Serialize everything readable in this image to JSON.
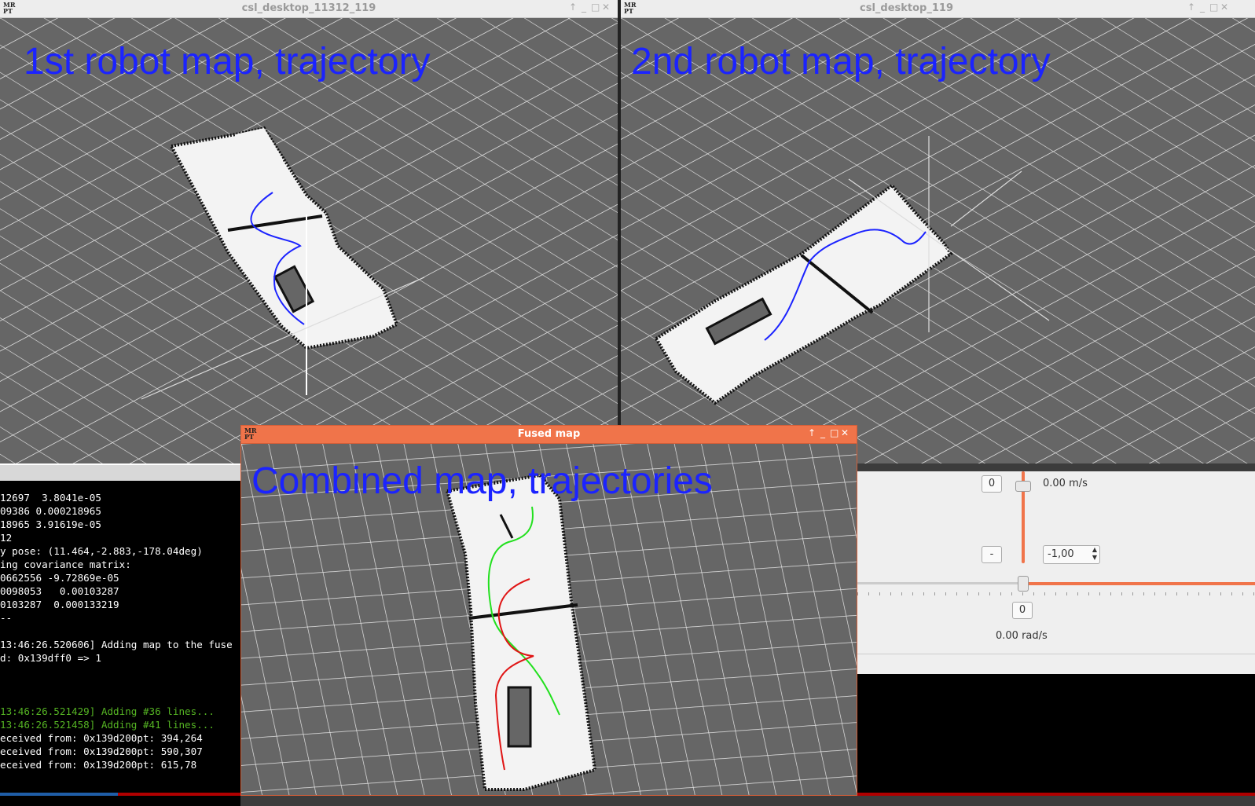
{
  "windows": {
    "robot1": {
      "title": "csl_desktop_11312_119",
      "caption": "1st robot map, trajectory",
      "logo": "MR PT",
      "controls": [
        "pin-icon",
        "minimize-icon",
        "maximize-icon",
        "close-icon"
      ]
    },
    "robot2": {
      "title": "csl_desktop_119",
      "caption": "2nd robot map, trajectory",
      "logo": "MR PT",
      "controls": [
        "pin-icon",
        "minimize-icon",
        "maximize-icon",
        "close-icon"
      ]
    },
    "fused": {
      "title": "Fused map",
      "caption": "Combined map, trajectories",
      "logo": "MR PT",
      "controls": [
        "pin-icon",
        "minimize-icon",
        "maximize-icon",
        "close-icon"
      ]
    }
  },
  "terminal": {
    "lines": [
      {
        "text": "12697  3.8041e-05",
        "color": "white"
      },
      {
        "text": "09386 0.000218965",
        "color": "white"
      },
      {
        "text": "18965 3.91619e-05",
        "color": "white"
      },
      {
        "text": "12",
        "color": "white"
      },
      {
        "text": "y pose: (11.464,-2.883,-178.04deg)",
        "color": "white"
      },
      {
        "text": "ing covariance matrix:",
        "color": "white"
      },
      {
        "text": "0662556 -9.72869e-05",
        "color": "white"
      },
      {
        "text": "0098053   0.00103287",
        "color": "white"
      },
      {
        "text": "0103287  0.000133219",
        "color": "white"
      },
      {
        "text": "--",
        "color": "white"
      },
      {
        "text": "",
        "color": "white"
      },
      {
        "text": "13:46:26.520606] Adding map to the fuse",
        "color": "white"
      },
      {
        "text": "d: 0x139dff0 => 1",
        "color": "white"
      },
      {
        "text": "",
        "color": "white"
      },
      {
        "text": "",
        "color": "white"
      },
      {
        "text": "",
        "color": "white"
      },
      {
        "text": "13:46:26.521429] Adding #36 lines...",
        "color": "green"
      },
      {
        "text": "13:46:26.521458] Adding #41 lines...",
        "color": "green"
      },
      {
        "text": "eceived from: 0x139d200pt: 394,264",
        "color": "white"
      },
      {
        "text": "eceived from: 0x139d200pt: 590,307",
        "color": "white"
      },
      {
        "text": "eceived from: 0x139d200pt: 615,78",
        "color": "white"
      }
    ]
  },
  "teleop": {
    "linear_box": "0",
    "linear_speed": "0.00 m/s",
    "linear_minus": "-",
    "scale_value": "-1,00",
    "angular_box": "0",
    "angular_speed": "0.00 rad/s",
    "linear_level": 0.0,
    "angular_level": 0.0
  },
  "colors": {
    "robot_traj": "#1b23ff",
    "fused_traj_a": "#22e01e",
    "fused_traj_b": "#e01515",
    "caption": "#1b23ff",
    "accent": "#f0744a"
  }
}
